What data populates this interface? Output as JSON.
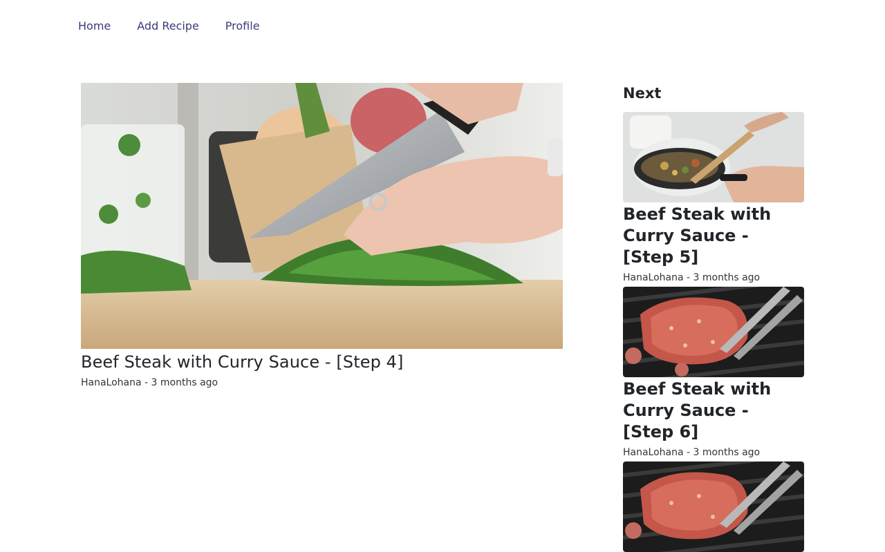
{
  "nav": {
    "home": "Home",
    "add_recipe": "Add Recipe",
    "profile": "Profile"
  },
  "main": {
    "title": "Beef Steak with Curry Sauce - [Step 4]",
    "author": "HanaLohana",
    "separator": " - ",
    "time": "3 months ago"
  },
  "sidebar": {
    "heading": "Next",
    "items": [
      {
        "title": "Beef Steak with Curry Sauce - [Step 5]",
        "author": "HanaLohana",
        "time": "3 months ago",
        "image": "pan-cooking"
      },
      {
        "title": "Beef Steak with Curry Sauce - [Step 6]",
        "author": "HanaLohana",
        "time": "3 months ago",
        "image": "grilled-steak"
      },
      {
        "title": "",
        "author": "",
        "time": "",
        "image": "grilled-steak"
      }
    ]
  }
}
